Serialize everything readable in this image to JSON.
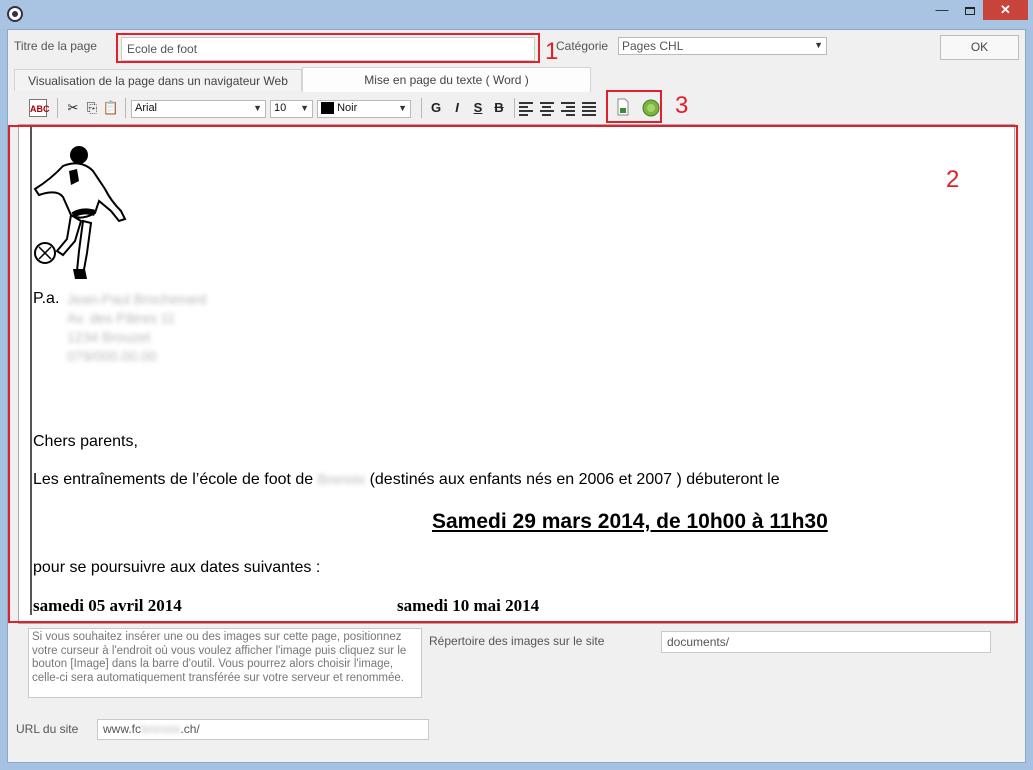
{
  "window": {
    "minimize_glyph": "—",
    "close_glyph": "✕"
  },
  "page_title": {
    "label": "Titre de la page",
    "value": "Ecole de foot"
  },
  "category": {
    "label": "Catégorie",
    "value": "Pages CHL"
  },
  "ok_button": "OK",
  "tabs": [
    {
      "label": "Visualisation de la page dans un navigateur Web",
      "active": false
    },
    {
      "label": "Mise en page du texte ( Word )",
      "active": true
    }
  ],
  "toolbar": {
    "font": "Arial",
    "size": "10",
    "color_label": "Noir",
    "bold": "G",
    "italic": "I",
    "underline": "S",
    "strike": "B"
  },
  "annotations": {
    "one": "1",
    "two": "2",
    "three": "3",
    "color": "#e0202a"
  },
  "document": {
    "pa": "P.a.",
    "address_lines": [
      "Jean-Paul Brochenard",
      "Av. des Pâtres 11",
      "1234 Brouzet",
      "079/000.00.00"
    ],
    "greeting": "Chers parents,",
    "intro_before": "Les entraînements de l’école de foot de",
    "intro_blurred": "Brenoix",
    "intro_after": "(destinés aux enfants nés en 2006 et 2007 ) débuteront le",
    "headline": "Samedi 29 mars 2014, de 10h00 à 11h30",
    "continue": "pour se poursuivre aux dates suivantes :",
    "date1": "samedi 05 avril  2014",
    "date2": "samedi  10  mai  2014"
  },
  "info_text": "Si vous souhaitez insérer une ou des images sur cette page, positionnez votre curseur à l'endroit où vous voulez afficher l'image puis cliquez sur le bouton [Image] dans la barre d'outil. Vous pourrez alors choisir l'image, celle-ci sera automatiquement transférée sur votre serveur et renommée.",
  "images_dir": {
    "label": "Répertoire des images sur le site",
    "value": "documents/"
  },
  "site_url": {
    "label": "URL du site",
    "prefix": "www.fc",
    "blurred": "brenoix",
    "suffix": ".ch/"
  }
}
